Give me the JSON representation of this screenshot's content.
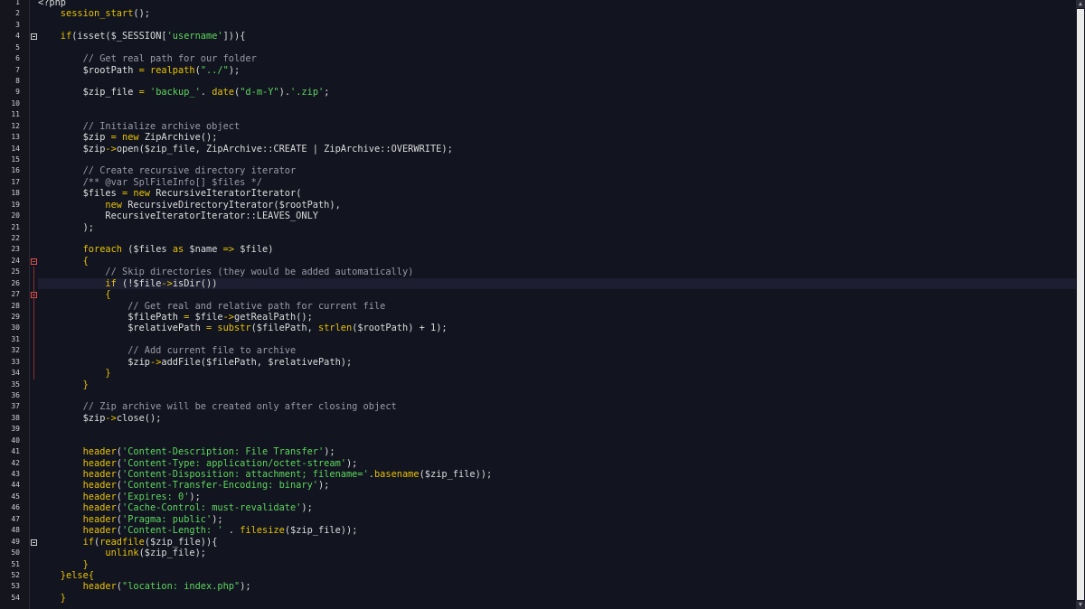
{
  "editor": {
    "language": "PHP",
    "current_line": 26,
    "lines": [
      {
        "n": "1",
        "segs": [
          [
            "default",
            "<?php"
          ]
        ]
      },
      {
        "n": "2",
        "segs": [
          [
            "kw",
            "    session_start"
          ],
          [
            "default",
            "();"
          ]
        ]
      },
      {
        "n": "3",
        "segs": []
      },
      {
        "n": "4",
        "segs": [
          [
            "kw",
            "    if"
          ],
          [
            "default",
            "(isset($_SESSION["
          ],
          [
            "str",
            "'username'"
          ],
          [
            "default",
            "])){"
          ]
        ]
      },
      {
        "n": "5",
        "segs": []
      },
      {
        "n": "6",
        "segs": [
          [
            "cmt",
            "        // Get real path for our folder"
          ]
        ]
      },
      {
        "n": "7",
        "segs": [
          [
            "var",
            "        $rootPath"
          ],
          [
            "op",
            " = "
          ],
          [
            "kw",
            "realpath"
          ],
          [
            "default",
            "("
          ],
          [
            "str",
            "\"../\""
          ],
          [
            "default",
            ");"
          ]
        ]
      },
      {
        "n": "8",
        "segs": []
      },
      {
        "n": "9",
        "segs": [
          [
            "var",
            "        $zip_file"
          ],
          [
            "op",
            " = "
          ],
          [
            "str",
            "'backup_'"
          ],
          [
            "default",
            ". "
          ],
          [
            "kw",
            "date"
          ],
          [
            "default",
            "("
          ],
          [
            "str",
            "\"d-m-Y\""
          ],
          [
            "default",
            ")."
          ],
          [
            "str",
            "'.zip'"
          ],
          [
            "default",
            ";"
          ]
        ]
      },
      {
        "n": "10",
        "segs": []
      },
      {
        "n": "11",
        "segs": []
      },
      {
        "n": "12",
        "segs": [
          [
            "cmt",
            "        // Initialize archive object"
          ]
        ]
      },
      {
        "n": "13",
        "segs": [
          [
            "var",
            "        $zip"
          ],
          [
            "op",
            " = "
          ],
          [
            "kw",
            "new "
          ],
          [
            "default",
            "ZipArchive();"
          ]
        ]
      },
      {
        "n": "14",
        "segs": [
          [
            "var",
            "        $zip"
          ],
          [
            "op",
            "->"
          ],
          [
            "default",
            "open($zip_file, ZipArchive::CREATE | ZipArchive::OVERWRITE);"
          ]
        ]
      },
      {
        "n": "15",
        "segs": []
      },
      {
        "n": "16",
        "segs": [
          [
            "cmt",
            "        // Create recursive directory iterator"
          ]
        ]
      },
      {
        "n": "17",
        "segs": [
          [
            "cmt",
            "        /** @var SplFileInfo[] $files */"
          ]
        ]
      },
      {
        "n": "18",
        "segs": [
          [
            "var",
            "        $files"
          ],
          [
            "op",
            " = "
          ],
          [
            "kw",
            "new "
          ],
          [
            "default",
            "RecursiveIteratorIterator("
          ]
        ]
      },
      {
        "n": "19",
        "segs": [
          [
            "kw",
            "            new "
          ],
          [
            "default",
            "RecursiveDirectoryIterator($rootPath),"
          ]
        ]
      },
      {
        "n": "20",
        "segs": [
          [
            "default",
            "            RecursiveIteratorIterator::LEAVES_ONLY"
          ]
        ]
      },
      {
        "n": "21",
        "segs": [
          [
            "default",
            "        );"
          ]
        ]
      },
      {
        "n": "22",
        "segs": []
      },
      {
        "n": "23",
        "segs": [
          [
            "kw",
            "        foreach "
          ],
          [
            "default",
            "($files "
          ],
          [
            "kw",
            "as "
          ],
          [
            "default",
            "$name "
          ],
          [
            "op",
            "=> "
          ],
          [
            "default",
            "$file)"
          ]
        ]
      },
      {
        "n": "24",
        "segs": [
          [
            "op",
            "        {"
          ]
        ]
      },
      {
        "n": "25",
        "segs": [
          [
            "cmt",
            "            // Skip directories (they would be added automatically)"
          ]
        ]
      },
      {
        "n": "26",
        "segs": [
          [
            "kw",
            "            if "
          ],
          [
            "default",
            "(!$file"
          ],
          [
            "op",
            "->"
          ],
          [
            "default",
            "isDir())"
          ]
        ]
      },
      {
        "n": "27",
        "segs": [
          [
            "op",
            "            {"
          ]
        ]
      },
      {
        "n": "28",
        "segs": [
          [
            "cmt",
            "                // Get real and relative path for current file"
          ]
        ]
      },
      {
        "n": "29",
        "segs": [
          [
            "var",
            "                $filePath"
          ],
          [
            "op",
            " = "
          ],
          [
            "default",
            "$file"
          ],
          [
            "op",
            "->"
          ],
          [
            "default",
            "getRealPath();"
          ]
        ]
      },
      {
        "n": "30",
        "segs": [
          [
            "var",
            "                $relativePath"
          ],
          [
            "op",
            " = "
          ],
          [
            "kw",
            "substr"
          ],
          [
            "default",
            "($filePath, "
          ],
          [
            "kw",
            "strlen"
          ],
          [
            "default",
            "($rootPath) + 1);"
          ]
        ]
      },
      {
        "n": "31",
        "segs": []
      },
      {
        "n": "32",
        "segs": [
          [
            "cmt",
            "                // Add current file to archive"
          ]
        ]
      },
      {
        "n": "33",
        "segs": [
          [
            "var",
            "                $zip"
          ],
          [
            "op",
            "->"
          ],
          [
            "default",
            "addFile($filePath, $relativePath);"
          ]
        ]
      },
      {
        "n": "34",
        "segs": [
          [
            "op",
            "            }"
          ]
        ]
      },
      {
        "n": "35",
        "segs": [
          [
            "op",
            "        }"
          ]
        ]
      },
      {
        "n": "36",
        "segs": []
      },
      {
        "n": "37",
        "segs": [
          [
            "cmt",
            "        // Zip archive will be created only after closing object"
          ]
        ]
      },
      {
        "n": "38",
        "segs": [
          [
            "var",
            "        $zip"
          ],
          [
            "op",
            "->"
          ],
          [
            "default",
            "close();"
          ]
        ]
      },
      {
        "n": "39",
        "segs": []
      },
      {
        "n": "40",
        "segs": []
      },
      {
        "n": "41",
        "segs": [
          [
            "kw",
            "        header"
          ],
          [
            "default",
            "("
          ],
          [
            "str",
            "'Content-Description: File Transfer'"
          ],
          [
            "default",
            ");"
          ]
        ]
      },
      {
        "n": "42",
        "segs": [
          [
            "kw",
            "        header"
          ],
          [
            "default",
            "("
          ],
          [
            "str",
            "'Content-Type: application/octet-stream'"
          ],
          [
            "default",
            ");"
          ]
        ]
      },
      {
        "n": "43",
        "segs": [
          [
            "kw",
            "        header"
          ],
          [
            "default",
            "("
          ],
          [
            "str",
            "'Content-Disposition: attachment; filename='"
          ],
          [
            "default",
            "."
          ],
          [
            "kw",
            "basename"
          ],
          [
            "default",
            "($zip_file));"
          ]
        ]
      },
      {
        "n": "44",
        "segs": [
          [
            "kw",
            "        header"
          ],
          [
            "default",
            "("
          ],
          [
            "str",
            "'Content-Transfer-Encoding: binary'"
          ],
          [
            "default",
            ");"
          ]
        ]
      },
      {
        "n": "45",
        "segs": [
          [
            "kw",
            "        header"
          ],
          [
            "default",
            "("
          ],
          [
            "str",
            "'Expires: 0'"
          ],
          [
            "default",
            ");"
          ]
        ]
      },
      {
        "n": "46",
        "segs": [
          [
            "kw",
            "        header"
          ],
          [
            "default",
            "("
          ],
          [
            "str",
            "'Cache-Control: must-revalidate'"
          ],
          [
            "default",
            ");"
          ]
        ]
      },
      {
        "n": "47",
        "segs": [
          [
            "kw",
            "        header"
          ],
          [
            "default",
            "("
          ],
          [
            "str",
            "'Pragma: public'"
          ],
          [
            "default",
            ");"
          ]
        ]
      },
      {
        "n": "48",
        "segs": [
          [
            "kw",
            "        header"
          ],
          [
            "default",
            "("
          ],
          [
            "str",
            "'Content-Length: '"
          ],
          [
            "default",
            " . "
          ],
          [
            "kw",
            "filesize"
          ],
          [
            "default",
            "($zip_file));"
          ]
        ]
      },
      {
        "n": "49",
        "segs": [
          [
            "kw",
            "        if"
          ],
          [
            "default",
            "("
          ],
          [
            "kw",
            "readfile"
          ],
          [
            "default",
            "($zip_file)){"
          ]
        ]
      },
      {
        "n": "50",
        "segs": [
          [
            "kw",
            "            unlink"
          ],
          [
            "default",
            "($zip_file);"
          ]
        ]
      },
      {
        "n": "51",
        "segs": [
          [
            "op",
            "        }"
          ]
        ]
      },
      {
        "n": "52",
        "segs": [
          [
            "op",
            "    }"
          ],
          [
            "kw",
            "else"
          ],
          [
            "op",
            "{"
          ]
        ]
      },
      {
        "n": "53",
        "segs": [
          [
            "kw",
            "        header"
          ],
          [
            "default",
            "("
          ],
          [
            "str",
            "\"location: index.php\""
          ],
          [
            "default",
            ");"
          ]
        ]
      },
      {
        "n": "54",
        "segs": [
          [
            "op",
            "    }"
          ]
        ]
      }
    ]
  },
  "fold_markers": [
    {
      "line": 4,
      "style": "normal"
    },
    {
      "line": 24,
      "style": "red"
    },
    {
      "line": 27,
      "style": "red"
    },
    {
      "line": 49,
      "style": "normal"
    }
  ],
  "scrollbar": {
    "up_icon": "arrow-up-icon",
    "down_icon": "arrow-down-icon"
  }
}
